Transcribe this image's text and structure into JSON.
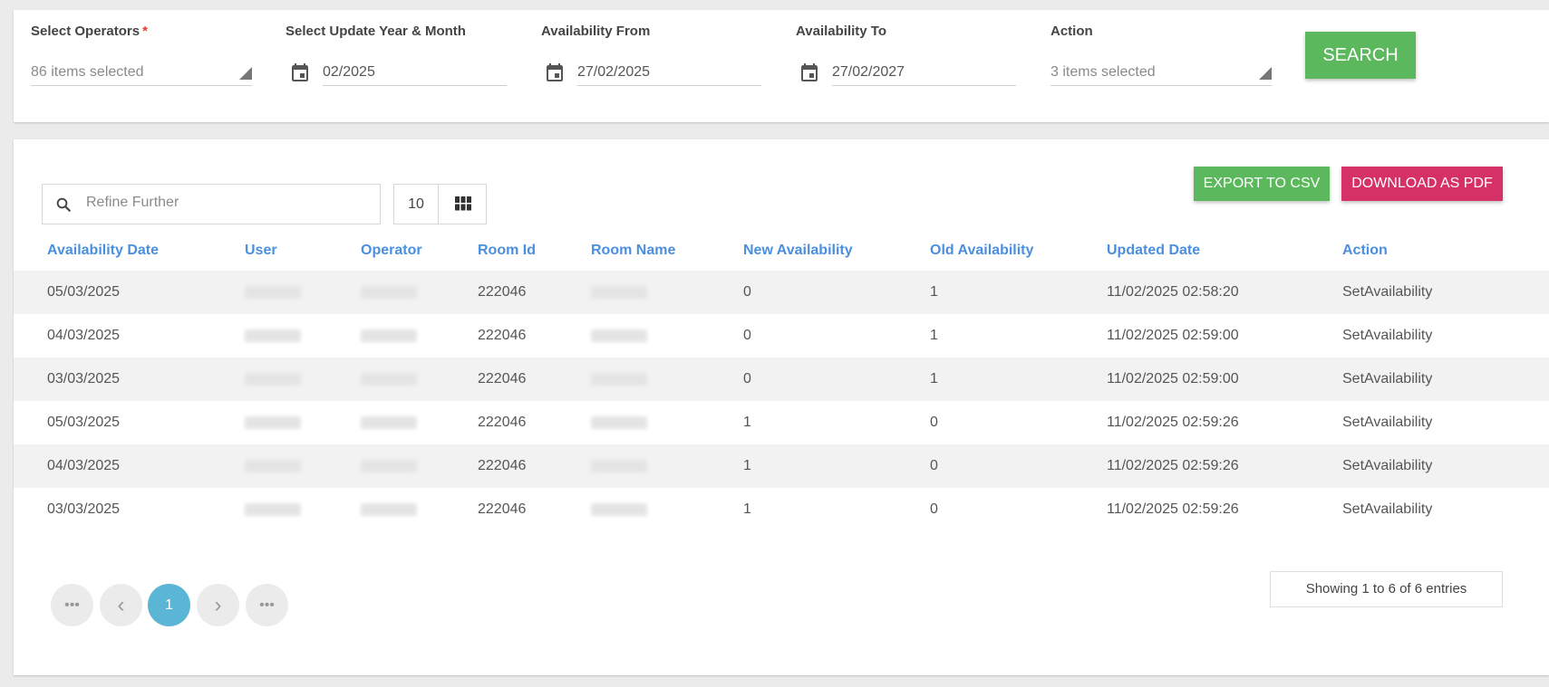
{
  "filters": {
    "operators": {
      "label": "Select Operators",
      "required_mark": "*",
      "value": "86 items selected"
    },
    "update_month": {
      "label": "Select Update Year & Month",
      "value": "02/2025"
    },
    "availability_from": {
      "label": "Availability From",
      "value": "27/02/2025"
    },
    "availability_to": {
      "label": "Availability To",
      "value": "27/02/2027"
    },
    "action": {
      "label": "Action",
      "value": "3 items selected"
    },
    "search_label": "SEARCH"
  },
  "toolbar": {
    "refine_placeholder": "Refine Further",
    "page_size": "10",
    "export_label": "EXPORT TO CSV",
    "pdf_label": "DOWNLOAD AS PDF"
  },
  "table": {
    "columns": [
      "Availability Date",
      "User",
      "Operator",
      "Room Id",
      "Room Name",
      "New Availability",
      "Old Availability",
      "Updated Date",
      "Action"
    ],
    "rows": [
      {
        "date": "05/03/2025",
        "room_id": "222046",
        "new": "0",
        "old": "1",
        "updated": "11/02/2025 02:58:20",
        "action": "SetAvailability"
      },
      {
        "date": "04/03/2025",
        "room_id": "222046",
        "new": "0",
        "old": "1",
        "updated": "11/02/2025 02:59:00",
        "action": "SetAvailability"
      },
      {
        "date": "03/03/2025",
        "room_id": "222046",
        "new": "0",
        "old": "1",
        "updated": "11/02/2025 02:59:00",
        "action": "SetAvailability"
      },
      {
        "date": "05/03/2025",
        "room_id": "222046",
        "new": "1",
        "old": "0",
        "updated": "11/02/2025 02:59:26",
        "action": "SetAvailability"
      },
      {
        "date": "04/03/2025",
        "room_id": "222046",
        "new": "1",
        "old": "0",
        "updated": "11/02/2025 02:59:26",
        "action": "SetAvailability"
      },
      {
        "date": "03/03/2025",
        "room_id": "222046",
        "new": "1",
        "old": "0",
        "updated": "11/02/2025 02:59:26",
        "action": "SetAvailability"
      }
    ]
  },
  "pagination": {
    "first": "•••",
    "prev": "‹",
    "current": "1",
    "next": "›",
    "last": "•••",
    "showing": "Showing 1 to 6 of 6 entries"
  },
  "colors": {
    "accent_green": "#5cb85c",
    "accent_pink": "#d63166",
    "header_blue": "#4a8fe0",
    "active_page": "#5ab6d4"
  }
}
